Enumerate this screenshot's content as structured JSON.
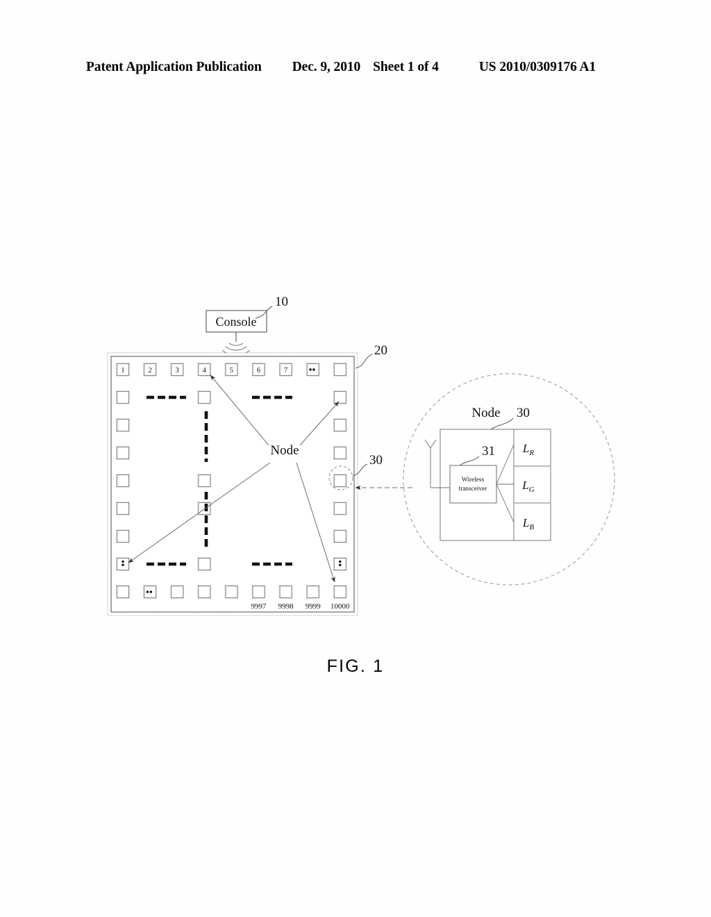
{
  "header": {
    "publication": "Patent Application Publication",
    "date": "Dec. 9, 2010",
    "sheet": "Sheet 1 of 4",
    "patent_number": "US 2010/0309176 A1"
  },
  "figure": {
    "caption": "FIG. 1",
    "console": {
      "label": "Console",
      "ref": "10",
      "icon": "wireless-waves-icon"
    },
    "panel": {
      "ref": "20",
      "center_label": "Node",
      "node_circle_ref": "30",
      "top_row_numbers": [
        "1",
        "2",
        "3",
        "4",
        "5",
        "6",
        "7"
      ],
      "top_row_ellipsis_cell": "..",
      "bottom_row_numbers": [
        "9997",
        "9998",
        "9999",
        "10000"
      ],
      "bottom_ellipsis_cell": "..",
      "corner_vertical_ellipsis": ":",
      "grid_columns": 9,
      "grid_rows": 9
    },
    "detail": {
      "title": "Node",
      "node_ref": "30",
      "transceiver_ref": "31",
      "transceiver_label_line1": "Wireless",
      "transceiver_label_line2": "transceiver",
      "antenna_icon": "antenna-icon",
      "leds": [
        {
          "base": "L",
          "sub": "R"
        },
        {
          "base": "L",
          "sub": "G"
        },
        {
          "base": "L",
          "sub": "B"
        }
      ]
    }
  },
  "colors": {
    "ink": "#111111",
    "line": "#4a4a4a",
    "cell_stroke": "#8a8a8a",
    "paper": "#ffffff"
  }
}
